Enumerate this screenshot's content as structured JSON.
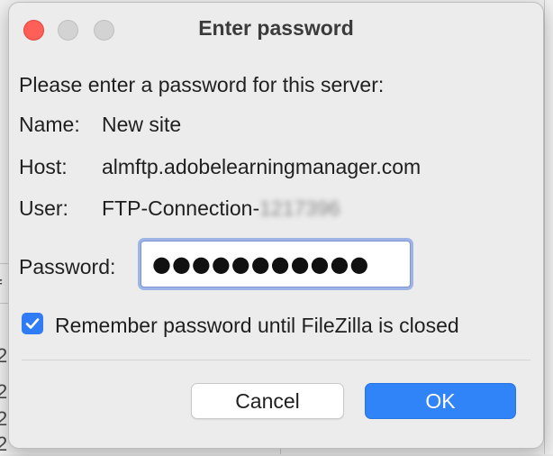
{
  "window": {
    "title": "Enter password"
  },
  "prompt": "Please enter a password for this server:",
  "info": {
    "name_label": "Name:",
    "name_value": "New site",
    "host_label": "Host:",
    "host_value": "almftp.adobelearningmanager.com",
    "user_label": "User:",
    "user_value": "FTP-Connection-",
    "user_redacted": "1217396"
  },
  "password": {
    "label": "Password:",
    "masked_value": "●●●●●●●●●●●"
  },
  "remember": {
    "checked": true,
    "label": "Remember password until FileZilla is closed"
  },
  "buttons": {
    "cancel": "Cancel",
    "ok": "OK"
  },
  "background": {
    "fragments": [
      "f",
      "2",
      "2",
      "2",
      "2"
    ]
  },
  "colors": {
    "accent": "#3184f7",
    "close": "#fe5f57"
  }
}
